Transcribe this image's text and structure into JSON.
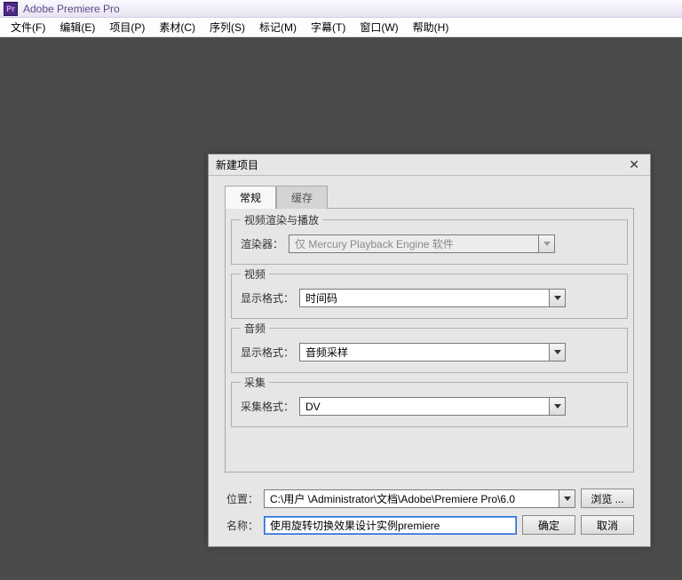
{
  "app": {
    "title": "Adobe Premiere Pro",
    "icon_text": "Pr"
  },
  "menubar": {
    "file": "文件(F)",
    "edit": "编辑(E)",
    "project": "项目(P)",
    "clip": "素材(C)",
    "sequence": "序列(S)",
    "marker": "标记(M)",
    "title": "字幕(T)",
    "window": "窗口(W)",
    "help": "帮助(H)"
  },
  "dialog": {
    "title": "新建项目",
    "tabs": {
      "general": "常规",
      "scratch": "缓存"
    },
    "render_group": "视频渲染与播放",
    "renderer_label": "渲染器：",
    "renderer_value": "仅 Mercury Playback Engine 软件",
    "video_group": "视频",
    "video_format_label": "显示格式：",
    "video_format_value": "时间码",
    "audio_group": "音频",
    "audio_format_label": "显示格式：",
    "audio_format_value": "音频采样",
    "capture_group": "采集",
    "capture_format_label": "采集格式：",
    "capture_format_value": "DV",
    "location_label": "位置：",
    "location_value": "C:\\用户 \\Administrator\\文档\\Adobe\\Premiere Pro\\6.0",
    "browse_label": "浏览 ...",
    "name_label": "名称：",
    "name_value": "使用旋转切换效果设计实例premiere",
    "ok_label": "确定",
    "cancel_label": "取消"
  }
}
